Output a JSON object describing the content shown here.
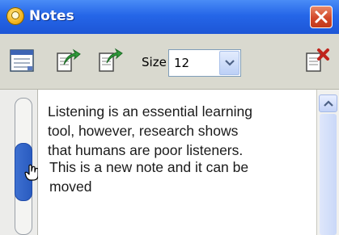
{
  "window": {
    "title": "Notes",
    "icon": "notes-app-icon"
  },
  "toolbar": {
    "size_label": "Size",
    "size_value": "12",
    "icons": [
      "notes-list-icon",
      "export-note-icon",
      "import-note-icon",
      "delete-note-icon"
    ]
  },
  "notes": [
    {
      "text": "Listening is an essential learning\ntool, however, research shows\nthat humans are poor listeners."
    },
    {
      "text": "This is a new note and it can be\nmoved"
    }
  ],
  "colors": {
    "titlebar": "#2566e8",
    "close_button": "#d2482a",
    "slider_thumb": "#2a5cc0",
    "toolbar_bg": "#d9d9cf"
  }
}
